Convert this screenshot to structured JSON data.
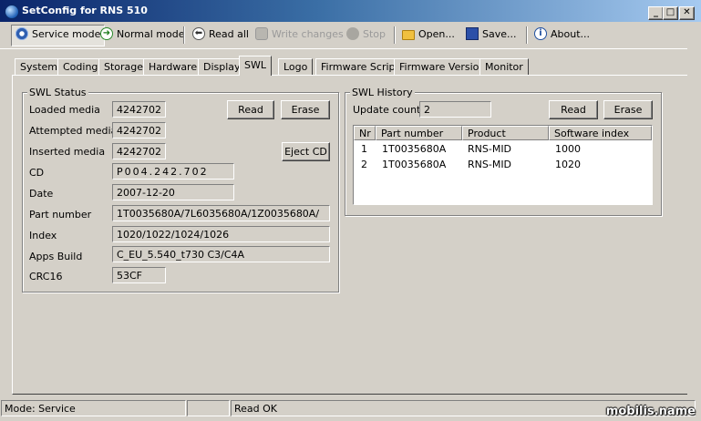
{
  "window": {
    "title": "SetConfig for RNS 510"
  },
  "toolbar": {
    "service_mode": "Service mode",
    "normal_mode": "Normal mode",
    "read_all": "Read all",
    "write_changes": "Write changes",
    "stop": "Stop",
    "open": "Open...",
    "save": "Save...",
    "about": "About..."
  },
  "tabs": [
    "System",
    "Coding",
    "Storage",
    "Hardware",
    "Display",
    "SWL",
    "Logo",
    "Firmware Script",
    "Firmware Version",
    "Monitor"
  ],
  "active_tab": "SWL",
  "swl_status": {
    "title": "SWL Status",
    "loaded_media": {
      "label": "Loaded media",
      "value": "4242702"
    },
    "attempted_media": {
      "label": "Attempted media",
      "value": "4242702"
    },
    "inserted_media": {
      "label": "Inserted media",
      "value": "4242702"
    },
    "cd": {
      "label": "CD",
      "value": "P004.242.702"
    },
    "date": {
      "label": "Date",
      "value": "2007-12-20"
    },
    "part_number": {
      "label": "Part number",
      "value": "1T0035680A/7L6035680A/1Z0035680A/"
    },
    "index": {
      "label": "Index",
      "value": "1020/1022/1024/1026"
    },
    "apps_build": {
      "label": "Apps Build",
      "value": "C_EU_5.540_t730 C3/C4A"
    },
    "crc16": {
      "label": "CRC16",
      "value": "53CF"
    },
    "read_button": "Read",
    "erase_button": "Erase",
    "eject_button": "Eject CD"
  },
  "swl_history": {
    "title": "SWL History",
    "update_count_label": "Update count",
    "update_count": "2",
    "read_button": "Read",
    "erase_button": "Erase",
    "columns": [
      "Nr",
      "Part number",
      "Product",
      "Software index"
    ],
    "rows": [
      [
        "1",
        "1T0035680A",
        "RNS-MID",
        "1000"
      ],
      [
        "2",
        "1T0035680A",
        "RNS-MID",
        "1020"
      ]
    ]
  },
  "statusbar": {
    "mode": "Mode: Service",
    "middle": "",
    "message": "Read OK"
  },
  "watermark": "mobilis.name"
}
